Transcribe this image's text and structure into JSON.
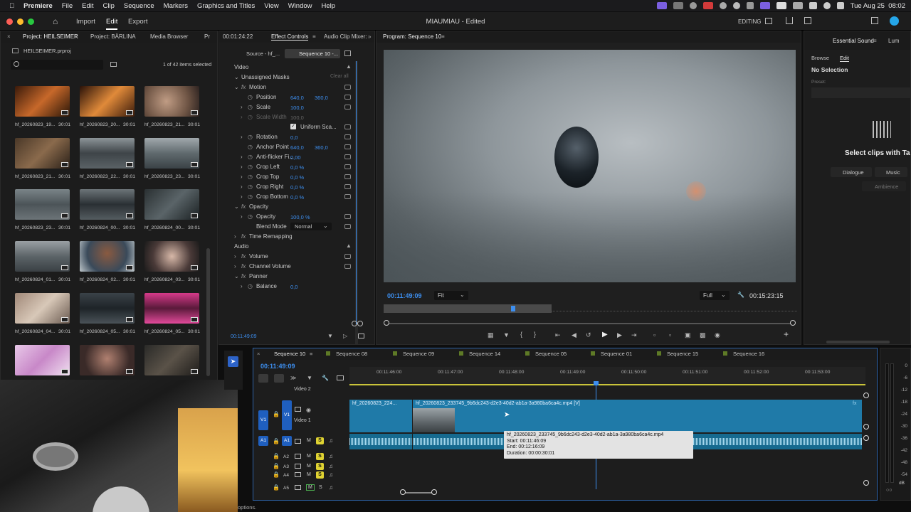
{
  "menubar": {
    "app": "Premiere",
    "items": [
      "File",
      "Edit",
      "Clip",
      "Sequence",
      "Markers",
      "Graphics and Titles",
      "View",
      "Window",
      "Help"
    ],
    "datetime": "Tue Aug 25  08:02"
  },
  "titlebar": {
    "nav": [
      "Import",
      "Edit",
      "Export"
    ],
    "active_nav": "Edit",
    "doc_title": "MIAUMIAU - Edited",
    "workspace": "EDITING"
  },
  "project": {
    "tabs": [
      "Project: HEILSEIMER",
      "Project: BÄRLINA",
      "Media Browser",
      "Pr"
    ],
    "file": "HEILSEIMER.prproj",
    "selection": "1 of 42 items selected",
    "items": [
      {
        "name": "hf_20260823_19...",
        "dur": "30:01"
      },
      {
        "name": "hf_20260823_20...",
        "dur": "30:01"
      },
      {
        "name": "hf_20260823_21...",
        "dur": "30:01"
      },
      {
        "name": "hf_20260823_21...",
        "dur": "30:01"
      },
      {
        "name": "hf_20260823_22...",
        "dur": "30:01"
      },
      {
        "name": "hf_20260823_23...",
        "dur": "30:01"
      },
      {
        "name": "hf_20260823_23...",
        "dur": "30:01"
      },
      {
        "name": "hf_20260824_00...",
        "dur": "30:01"
      },
      {
        "name": "hf_20260824_00...",
        "dur": "30:01"
      },
      {
        "name": "hf_20260824_01...",
        "dur": "30:01"
      },
      {
        "name": "hf_20260824_02...",
        "dur": "30:01"
      },
      {
        "name": "hf_20260824_03...",
        "dur": "30:01"
      },
      {
        "name": "hf_20260824_04...",
        "dur": "30:01"
      },
      {
        "name": "hf_20260824_05...",
        "dur": "30:01"
      },
      {
        "name": "hf_20260824_05...",
        "dur": "30:01"
      }
    ]
  },
  "effects": {
    "timecode_tab": "00:01:24:22",
    "tabs": [
      "Effect Controls",
      "Audio Clip Mixer:"
    ],
    "source_tab": "Source - hf_...",
    "seq_tab": "Sequence 10 -...",
    "video_label": "Video",
    "masks_label": "Unassigned Masks",
    "clear_all": "Clear all",
    "motion": "Motion",
    "position": {
      "label": "Position",
      "x": "640,0",
      "y": "360,0"
    },
    "scale": {
      "label": "Scale",
      "value": "100,0"
    },
    "scale_width": {
      "label": "Scale Width",
      "value": "100,0"
    },
    "uniform_scale": "Uniform Sca...",
    "rotation": {
      "label": "Rotation",
      "value": "0,0"
    },
    "anchor": {
      "label": "Anchor Point",
      "x": "640,0",
      "y": "360,0"
    },
    "antiflicker": {
      "label": "Anti-flicker Fi...",
      "value": "0,00"
    },
    "crop_left": {
      "label": "Crop Left",
      "value": "0,0 %"
    },
    "crop_top": {
      "label": "Crop Top",
      "value": "0,0 %"
    },
    "crop_right": {
      "label": "Crop Right",
      "value": "0,0 %"
    },
    "crop_bottom": {
      "label": "Crop Bottom",
      "value": "0,0 %"
    },
    "opacity_group": "Opacity",
    "opacity": {
      "label": "Opacity",
      "value": "100,0 %"
    },
    "blend": {
      "label": "Blend Mode",
      "value": "Normal"
    },
    "time_remap": "Time Remapping",
    "audio_label": "Audio",
    "volume": "Volume",
    "channel_volume": "Channel Volume",
    "panner": "Panner",
    "balance": {
      "label": "Balance",
      "value": "0,0"
    },
    "footer_tc": "00:11:49:09"
  },
  "program": {
    "title": "Program: Sequence 10",
    "timecode": "00:11:49:09",
    "fit": "Fit",
    "quality": "Full",
    "duration": "00:15:23:15"
  },
  "essential": {
    "tabs": [
      "Essential Sound",
      "Lum"
    ],
    "subtabs": [
      "Browse",
      "Edit"
    ],
    "no_selection": "No Selection",
    "preset": "Preset:",
    "select_text": "Select clips with Ta",
    "buttons": [
      "Dialogue",
      "Music",
      "Ambience"
    ]
  },
  "timeline": {
    "tabs": [
      "Sequence 10",
      "Sequence 08",
      "Sequence 09",
      "Sequence 14",
      "Sequence 05",
      "Sequence 01",
      "Sequence 15",
      "Sequence 16"
    ],
    "timecode": "00:11:49:09",
    "ruler": [
      "00:11:46:00",
      "00:11:47:00",
      "00:11:48:00",
      "00:11:49:00",
      "00:11:50:00",
      "00:11:51:00",
      "00:11:52:00",
      "00:11:53:00"
    ],
    "video2": "Video 2",
    "video1": "Video 1",
    "v1": "V1",
    "a1": "A1",
    "a2": "A2",
    "a3": "A3",
    "a4": "A4",
    "a5": "A5",
    "m": "M",
    "s": "S",
    "clip1": "hf_20260823_224...",
    "clip2": "hf_20260823_233745_9b6dc243-d2e3-40d2-ab1a-3a980ba6ca4c.mp4 [V]",
    "tooltip": {
      "name": "hf_20260823_233745_9b6dc243-d2e3-40d2-ab1a-3a980ba6ca4c.mp4",
      "start": "Start: 00:11:46:09",
      "end": "End: 00:12:16:09",
      "duration": "Duration: 00:00:30:01"
    }
  },
  "meters": {
    "labels": [
      "0",
      "-6",
      "-12",
      "-18",
      "-24",
      "-30",
      "-36",
      "-42",
      "-48",
      "-54"
    ],
    "db": "dB"
  },
  "status": "options."
}
